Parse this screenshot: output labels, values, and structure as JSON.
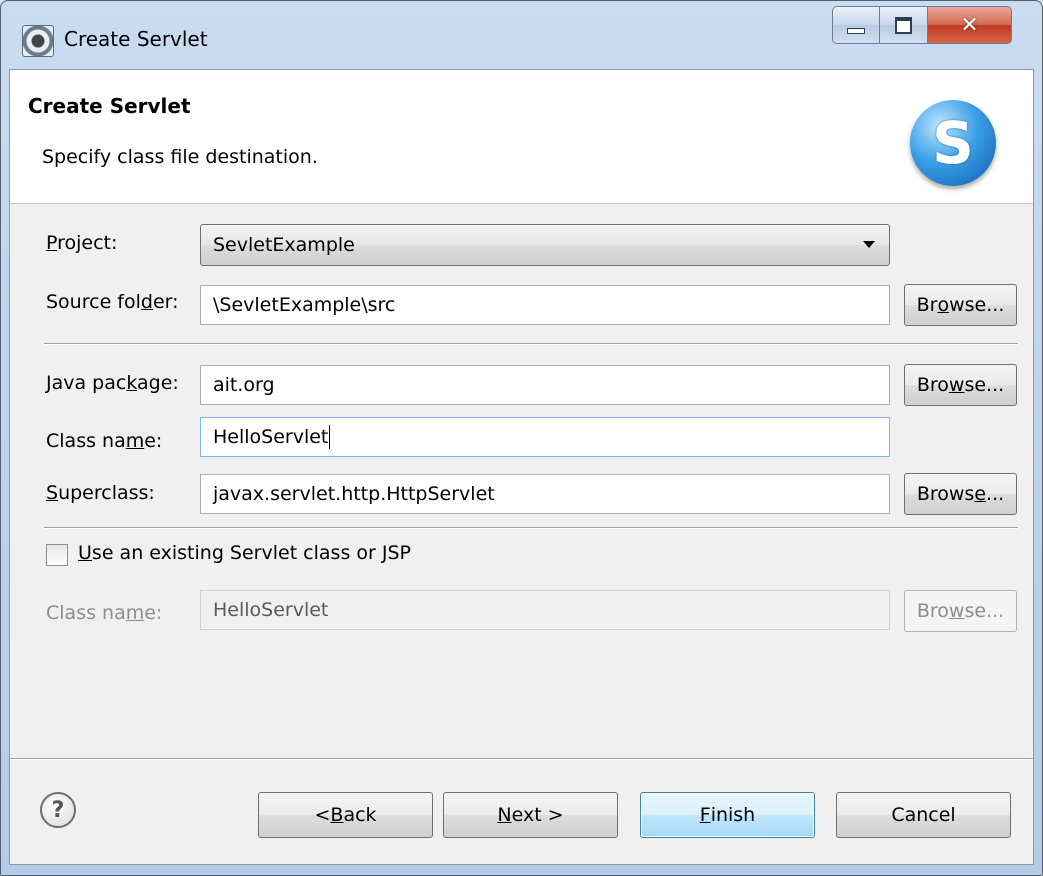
{
  "window": {
    "title": "Create Servlet"
  },
  "banner": {
    "title": "Create Servlet",
    "description": "Specify class file destination."
  },
  "form": {
    "project": {
      "label": "Project:",
      "value": "SevletExample"
    },
    "source_folder": {
      "label": "Source folder:",
      "value": "\\SevletExample\\src",
      "browse": "Browse..."
    },
    "java_package": {
      "label": "Java package:",
      "value": "ait.org",
      "browse": "Browse..."
    },
    "class_name": {
      "label": "Class name:",
      "value": "HelloServlet"
    },
    "superclass": {
      "label": "Superclass:",
      "value": "javax.servlet.http.HttpServlet",
      "browse": "Browse..."
    },
    "use_existing": {
      "label": "Use an existing Servlet class or JSP",
      "checked": false
    },
    "existing_class_name": {
      "label": "Class name:",
      "value": "HelloServlet",
      "browse": "Browse...",
      "enabled": false
    }
  },
  "footer": {
    "help_icon": "help-icon",
    "back": "< Back",
    "next": "Next >",
    "finish": "Finish",
    "cancel": "Cancel"
  },
  "colors": {
    "default_button_border": "#3c7fb1",
    "close_button": "#c0391f"
  }
}
